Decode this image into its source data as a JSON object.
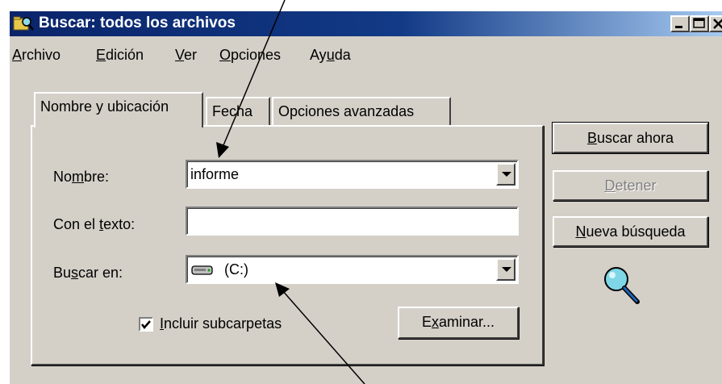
{
  "window": {
    "title": "Buscar: todos los archivos",
    "controls": [
      "minimize",
      "maximize",
      "close"
    ]
  },
  "menu": [
    {
      "pre": "",
      "key": "A",
      "post": "rchivo"
    },
    {
      "pre": "",
      "key": "E",
      "post": "dición"
    },
    {
      "pre": "",
      "key": "V",
      "post": "er"
    },
    {
      "pre": "",
      "key": "O",
      "post": "pciones"
    },
    {
      "pre": "Ay",
      "key": "u",
      "post": "da"
    }
  ],
  "tabs": [
    {
      "label": "Nombre y ubicación"
    },
    {
      "label": "Fecha"
    },
    {
      "label": "Opciones avanzadas"
    }
  ],
  "form": {
    "nombre": {
      "pre": "No",
      "key": "m",
      "post": "bre:",
      "value": "informe"
    },
    "texto": {
      "pre": "Con el ",
      "key": "t",
      "post": "exto:",
      "value": ""
    },
    "buscar_en": {
      "pre": "Bu",
      "key": "s",
      "post": "car en:",
      "value": "(C:)",
      "icon": "drive-icon"
    },
    "subcarpetas": {
      "key": "I",
      "post": "ncluir subcarpetas",
      "checked": true
    },
    "examinar": {
      "pre": "E",
      "key": "x",
      "post": "aminar..."
    }
  },
  "buttons": {
    "buscar_ahora": {
      "key": "B",
      "post": "uscar ahora"
    },
    "detener": {
      "key": "D",
      "post": "etener"
    },
    "nueva": {
      "key": "N",
      "post": "ueva búsqueda"
    }
  },
  "icons": {
    "search_animation": "magnifier-icon",
    "title": "search-folder-icon"
  }
}
